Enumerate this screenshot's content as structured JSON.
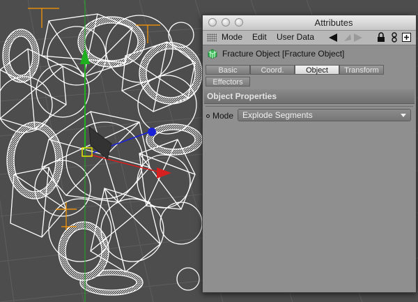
{
  "window": {
    "title": "Attributes"
  },
  "menu": {
    "items": [
      "Mode",
      "Edit",
      "User Data"
    ]
  },
  "object": {
    "title": "Fracture Object [Fracture Object]"
  },
  "tabs": [
    {
      "label": "Basic",
      "active": false
    },
    {
      "label": "Coord.",
      "active": false
    },
    {
      "label": "Object",
      "active": true
    },
    {
      "label": "Transform",
      "active": false
    },
    {
      "label": "Effectors",
      "active": false
    }
  ],
  "section": {
    "title": "Object Properties"
  },
  "properties": {
    "mode_label": "Mode",
    "mode_value": "Explode Segments"
  },
  "icons": {
    "grip": "grip-icon",
    "back": "arrow-left-icon",
    "forward": "arrow-right-icon",
    "lock": "lock-icon",
    "link": "link-icon",
    "new": "new-window-icon",
    "object": "fracture-object-icon"
  },
  "colors": {
    "axis_x": "#d62020",
    "axis_y": "#1fb01f",
    "axis_z": "#1a22d8",
    "selection": "#e8e800",
    "bbox": "#ff9900",
    "wireframe": "#ffffff"
  }
}
